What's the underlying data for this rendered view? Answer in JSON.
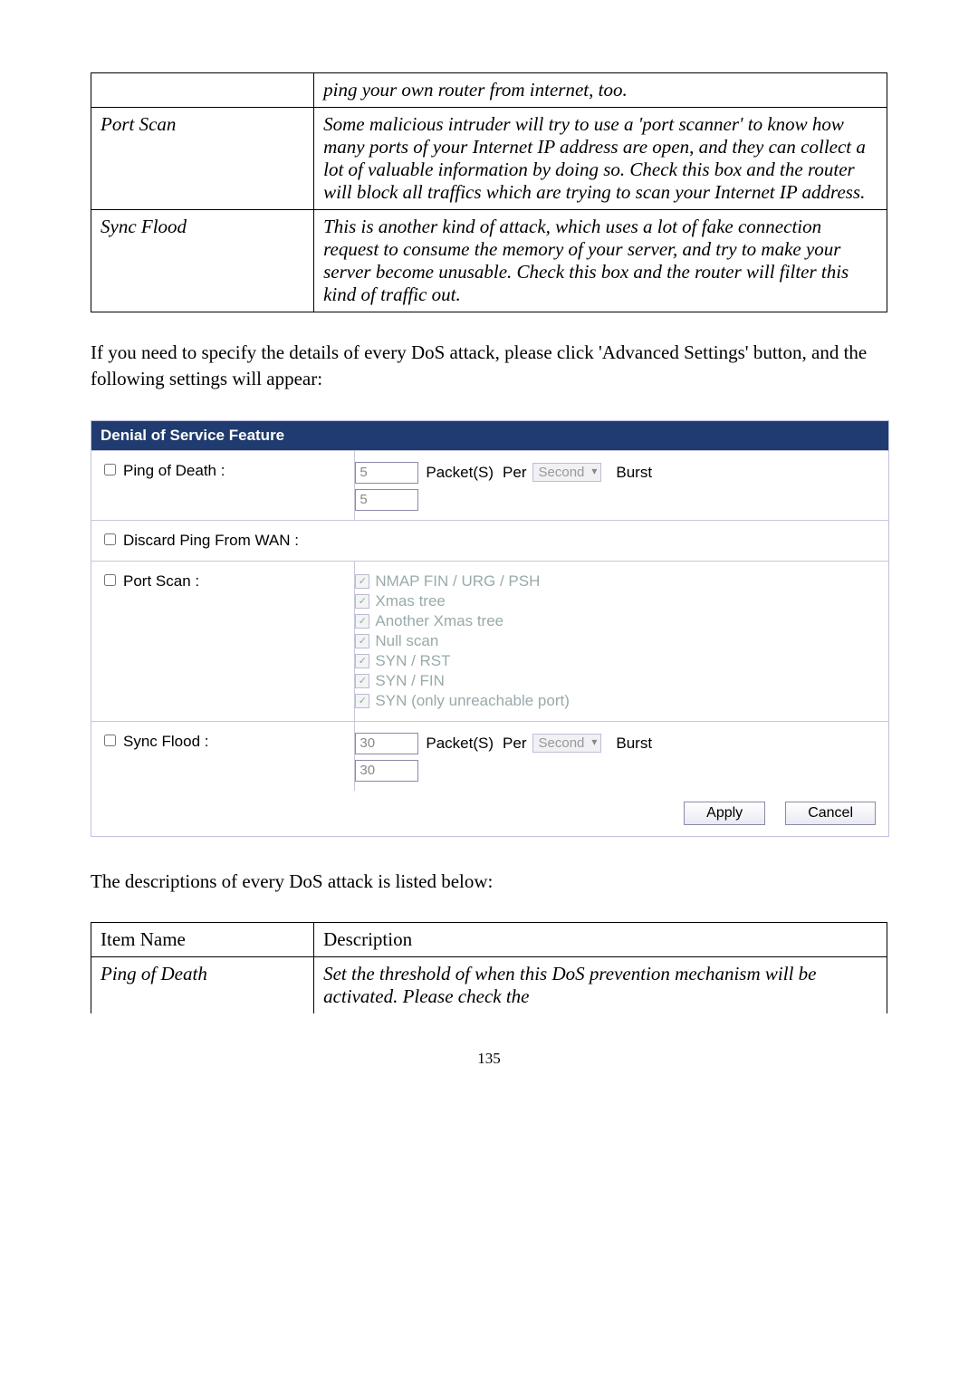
{
  "table1": {
    "rows": [
      {
        "name": "",
        "desc": "ping your own router from internet, too."
      },
      {
        "name": "Port Scan",
        "desc": "Some malicious intruder will try to use a 'port scanner' to know how many ports of your Internet IP address are open, and they can collect a lot of valuable information by doing so. Check this box and the router will block all traffics which are trying to scan your Internet IP address."
      },
      {
        "name": "Sync Flood",
        "desc": "This is another kind of attack, which uses a lot of fake connection request to consume the memory of your server, and try to make your server become unusable. Check this box and the router will filter this kind of traffic out."
      }
    ]
  },
  "paragraph1": "If you need to specify the details of every DoS attack, please click 'Advanced Settings' button, and the following settings will appear:",
  "ui": {
    "header": "Denial of Service Feature",
    "pingOfDeath": {
      "label": "Ping of Death :",
      "val1": "5",
      "packets": "Packet(S)",
      "per": "Per",
      "unit": "Second",
      "burst": "Burst",
      "val2": "5"
    },
    "discard": {
      "label": "Discard Ping From WAN :"
    },
    "portScan": {
      "label": "Port Scan :",
      "items": [
        "NMAP FIN / URG / PSH",
        "Xmas tree",
        "Another Xmas tree",
        "Null scan",
        "SYN / RST",
        "SYN / FIN",
        "SYN (only unreachable port)"
      ]
    },
    "syncFlood": {
      "label": "Sync Flood :",
      "val1": "30",
      "packets": "Packet(S)",
      "per": "Per",
      "unit": "Second",
      "burst": "Burst",
      "val2": "30"
    },
    "apply": "Apply",
    "cancel": "Cancel"
  },
  "paragraph2": "The descriptions of every DoS attack is listed below:",
  "table2": {
    "headers": {
      "name": "Item Name",
      "desc": "Description"
    },
    "rows": [
      {
        "name": "Ping of Death",
        "desc": "Set the threshold of when this DoS prevention mechanism will be activated. Please check the"
      }
    ]
  },
  "pagenum": "135"
}
